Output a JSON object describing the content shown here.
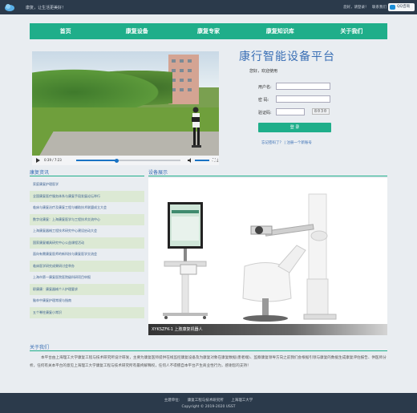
{
  "topbar": {
    "welcome": "康复，让生活更美好！",
    "links": [
      "您好，请登录！",
      "联系我们"
    ],
    "qq_label": "QQ咨询"
  },
  "nav": [
    "首页",
    "康复设备",
    "康复专家",
    "康复知识库",
    "关于我们"
  ],
  "video": {
    "time": "0:39 / 7:23"
  },
  "login": {
    "title": "康行智能设备平台",
    "greeting": "您好，欢迎使用",
    "user_label": "用户名:",
    "pass_label": "密 码:",
    "captcha_label": "验证码:",
    "captcha_value": "8030",
    "button": "登 录",
    "links": "忘记密码了？ | 注册一个新账号"
  },
  "news": {
    "title": "康复资讯",
    "items": [
      "家庭康复护理医学",
      "全国康复医疗服务体系与康复手段发展论坛举行",
      "临床与康复治疗及康复工程与辅助技术联盟成立大会",
      "数字化康复：上海康复医学与工程技术交流中心",
      "上海康复器械工程技术研究中心建设启动大会",
      "国家康复辅具研究中心公益课程活动",
      "面向有需康复医师的新科技与康复医学交流会",
      "临床医学研究成果研讨会举办",
      "上海市第一康复医院医院级科研项目申报",
      "职康康：康复器械个人护理要求",
      "脑卒中康复护理常规与指南",
      "五个脊柱康复小常识"
    ]
  },
  "device": {
    "title": "设备展示",
    "caption": "XYKSZFK-1 上肢康复机器人"
  },
  "about": {
    "title": "关于我们",
    "text": "本平台由上海理工大学康复工程与技术研究所设计研发，主要为康复医师提供在线监控康复设备及为康复对象在康复数据(患者端)、监察康复领导方向之前我们会根据引领与康复的数据生成康复评估报告、供医师分析，任何有关本平台的意见上海理工大学康复工程与技术研究所有最终解释权，任何人不得擅自本平台产生商业性行为，感谢您的支持！"
  },
  "footer": {
    "line1": [
      "主建单位:",
      "康复工程与技术研究所",
      "上海理工大学"
    ],
    "copyright": "Copyright © 2019-2020 USST"
  },
  "colors": {
    "accent": "#1fae8a",
    "heading_blue": "#3a6fb5",
    "dark": "#2b3a4b"
  }
}
